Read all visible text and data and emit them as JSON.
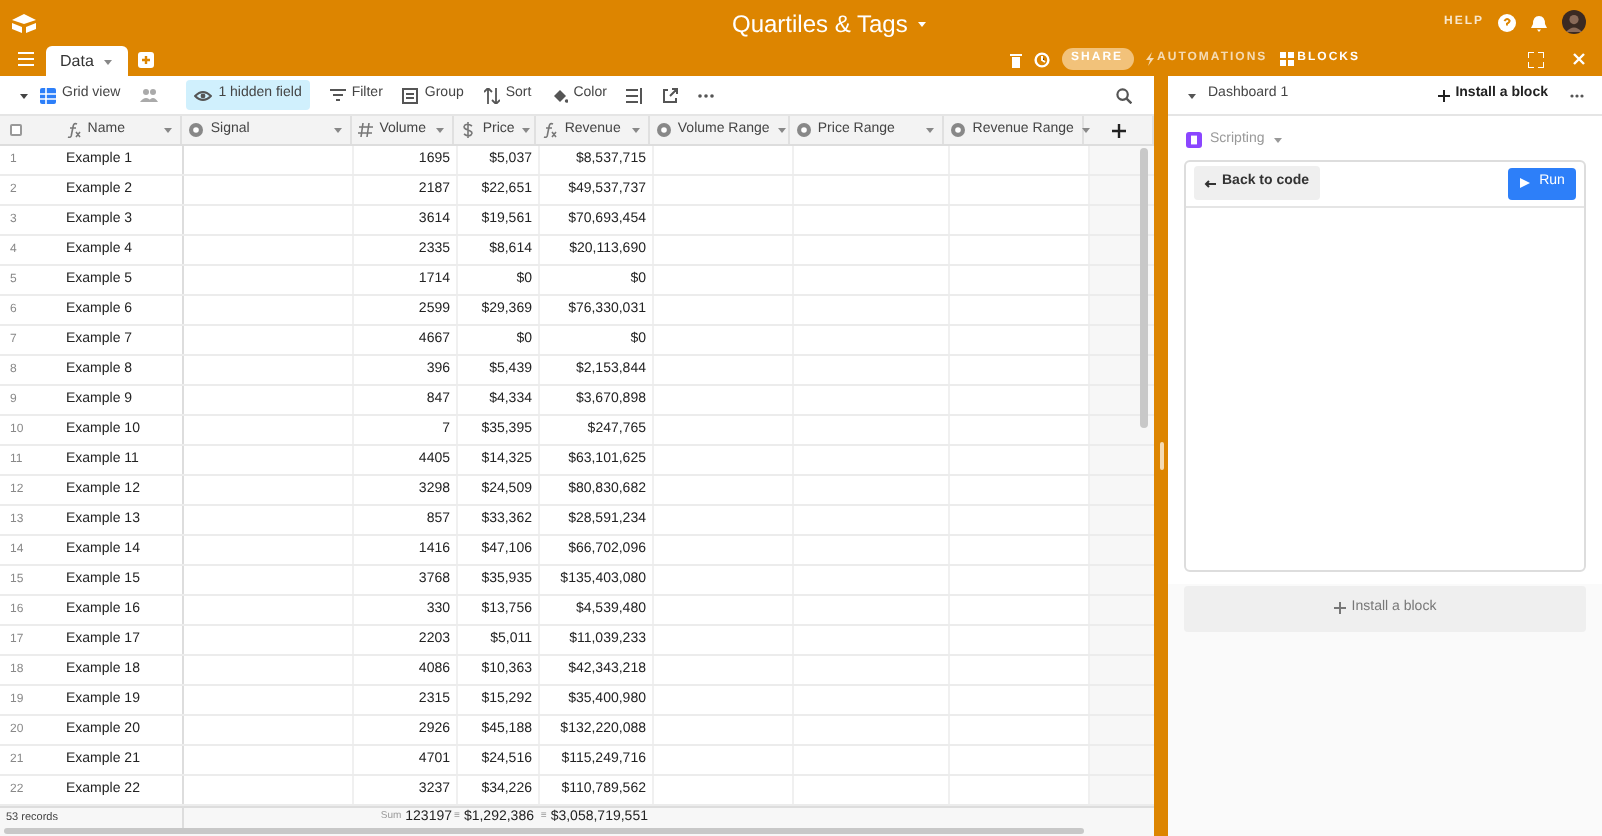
{
  "window": {
    "title": "Quartiles & Tags"
  },
  "header": {
    "help": "HELP",
    "share": "SHARE",
    "automations": "AUTOMATIONS",
    "blocks": "BLOCKS"
  },
  "tabs": [
    {
      "label": "Data",
      "selected": true
    }
  ],
  "toolbar": {
    "view": "Grid view",
    "hidden": "1 hidden field",
    "items": [
      "Filter",
      "Group",
      "Sort",
      "Color"
    ]
  },
  "table": {
    "select_all": {
      "checked": false
    },
    "columns": [
      {
        "label": "Name",
        "kind": "formula"
      },
      {
        "label": "Signal",
        "kind": "select"
      },
      {
        "label": "Volume",
        "kind": "number"
      },
      {
        "label": "Price",
        "kind": "currency"
      },
      {
        "label": "Revenue",
        "kind": "formula"
      },
      {
        "label": "Volume Range",
        "kind": "select"
      },
      {
        "label": "Price Range",
        "kind": "select"
      },
      {
        "label": "Revenue Range",
        "kind": "select"
      }
    ],
    "rows": [
      {
        "number": "1",
        "name": "Example 1",
        "volume": "1695",
        "price": "$5,037",
        "revenue": "$8,537,715"
      },
      {
        "number": "2",
        "name": "Example 2",
        "volume": "2187",
        "price": "$22,651",
        "revenue": "$49,537,737"
      },
      {
        "number": "3",
        "name": "Example 3",
        "volume": "3614",
        "price": "$19,561",
        "revenue": "$70,693,454"
      },
      {
        "number": "4",
        "name": "Example 4",
        "volume": "2335",
        "price": "$8,614",
        "revenue": "$20,113,690"
      },
      {
        "number": "5",
        "name": "Example 5",
        "volume": "1714",
        "price": "$0",
        "revenue": "$0"
      },
      {
        "number": "6",
        "name": "Example 6",
        "volume": "2599",
        "price": "$29,369",
        "revenue": "$76,330,031"
      },
      {
        "number": "7",
        "name": "Example 7",
        "volume": "4667",
        "price": "$0",
        "revenue": "$0"
      },
      {
        "number": "8",
        "name": "Example 8",
        "volume": "396",
        "price": "$5,439",
        "revenue": "$2,153,844"
      },
      {
        "number": "9",
        "name": "Example 9",
        "volume": "847",
        "price": "$4,334",
        "revenue": "$3,670,898"
      },
      {
        "number": "10",
        "name": "Example 10",
        "volume": "7",
        "price": "$35,395",
        "revenue": "$247,765"
      },
      {
        "number": "11",
        "name": "Example 11",
        "volume": "4405",
        "price": "$14,325",
        "revenue": "$63,101,625"
      },
      {
        "number": "12",
        "name": "Example 12",
        "volume": "3298",
        "price": "$24,509",
        "revenue": "$80,830,682"
      },
      {
        "number": "13",
        "name": "Example 13",
        "volume": "857",
        "price": "$33,362",
        "revenue": "$28,591,234"
      },
      {
        "number": "14",
        "name": "Example 14",
        "volume": "1416",
        "price": "$47,106",
        "revenue": "$66,702,096"
      },
      {
        "number": "15",
        "name": "Example 15",
        "volume": "3768",
        "price": "$35,935",
        "revenue": "$135,403,080"
      },
      {
        "number": "16",
        "name": "Example 16",
        "volume": "330",
        "price": "$13,756",
        "revenue": "$4,539,480"
      },
      {
        "number": "17",
        "name": "Example 17",
        "volume": "2203",
        "price": "$5,011",
        "revenue": "$11,039,233"
      },
      {
        "number": "18",
        "name": "Example 18",
        "volume": "4086",
        "price": "$10,363",
        "revenue": "$42,343,218"
      },
      {
        "number": "19",
        "name": "Example 19",
        "volume": "2315",
        "price": "$15,292",
        "revenue": "$35,400,980"
      },
      {
        "number": "20",
        "name": "Example 20",
        "volume": "2926",
        "price": "$45,188",
        "revenue": "$132,220,088"
      },
      {
        "number": "21",
        "name": "Example 21",
        "volume": "4701",
        "price": "$24,516",
        "revenue": "$115,249,716"
      },
      {
        "number": "22",
        "name": "Example 22",
        "volume": "3237",
        "price": "$34,226",
        "revenue": "$110,789,562"
      }
    ],
    "footer": {
      "records": "53 records",
      "volume_label": "Sum",
      "volume_sum": "123197",
      "price_label": "≡",
      "price_sum": "$1,292,386",
      "revenue_label": "≡",
      "revenue_sum": "$3,058,719,551"
    }
  },
  "dashboard": {
    "title": "Dashboard 1",
    "install": "Install a block",
    "app": "Scripting",
    "back": "Back to code",
    "run": "Run",
    "install_bottom": "Install a block"
  }
}
